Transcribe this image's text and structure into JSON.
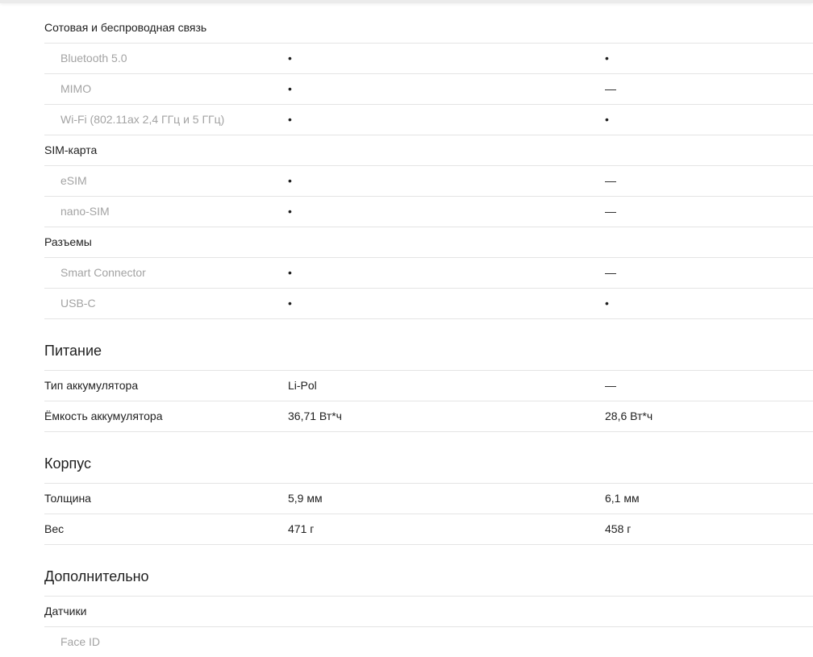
{
  "sections": {
    "connectivity": {
      "rows": [
        {
          "label": "Сотовая и беспроводная связь",
          "a": "",
          "b": ""
        },
        {
          "label": "Bluetooth 5.0",
          "a": "•",
          "b": "•"
        },
        {
          "label": "MIMO",
          "a": "•",
          "b": "—"
        },
        {
          "label": "Wi-Fi (802.11ax 2,4 ГГц и 5 ГГц)",
          "a": "•",
          "b": "•"
        },
        {
          "label": "SIM-карта",
          "a": "",
          "b": ""
        },
        {
          "label": "eSIM",
          "a": "•",
          "b": "—"
        },
        {
          "label": "nano-SIM",
          "a": "•",
          "b": "—"
        },
        {
          "label": "Разъемы",
          "a": "",
          "b": ""
        },
        {
          "label": "Smart Connector",
          "a": "•",
          "b": "—"
        },
        {
          "label": "USB-C",
          "a": "•",
          "b": "•"
        }
      ]
    },
    "power": {
      "title": "Питание",
      "rows": [
        {
          "label": "Тип аккумулятора",
          "a": "Li-Pol",
          "b": "—"
        },
        {
          "label": "Ёмкость аккумулятора",
          "a": "36,71 Вт*ч",
          "b": "28,6 Вт*ч"
        }
      ]
    },
    "body": {
      "title": "Корпус",
      "rows": [
        {
          "label": "Толщина",
          "a": "5,9 мм",
          "b": "6,1 мм"
        },
        {
          "label": "Вес",
          "a": "471 г",
          "b": "458 г"
        }
      ]
    },
    "extra": {
      "title": "Дополнительно",
      "rows": [
        {
          "label": "Датчики",
          "a": "",
          "b": ""
        },
        {
          "label": "Face ID",
          "a": "",
          "b": ""
        }
      ]
    }
  }
}
